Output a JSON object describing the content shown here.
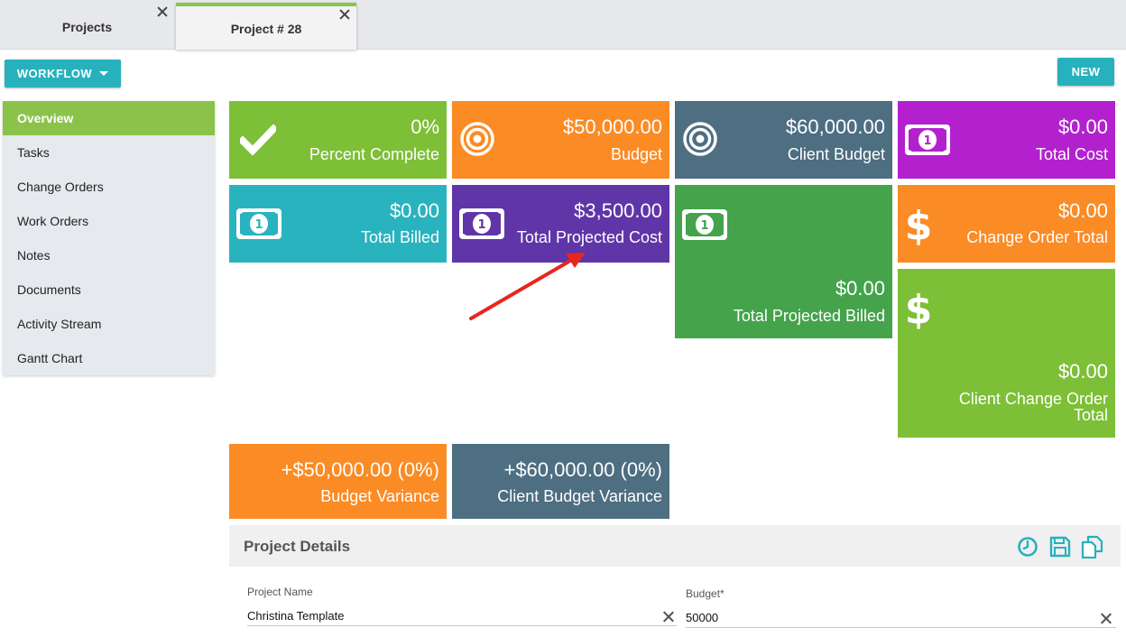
{
  "tabs": [
    {
      "label": "Projects"
    },
    {
      "label": "Project # 28"
    }
  ],
  "toolbar": {
    "workflow_label": "WORKFLOW",
    "new_label": "NEW"
  },
  "sidebar": {
    "items": [
      {
        "label": "Overview",
        "active": true
      },
      {
        "label": "Tasks"
      },
      {
        "label": "Change Orders"
      },
      {
        "label": "Work Orders"
      },
      {
        "label": "Notes"
      },
      {
        "label": "Documents"
      },
      {
        "label": "Activity Stream"
      },
      {
        "label": "Gantt Chart"
      }
    ]
  },
  "tiles": {
    "percent_complete": {
      "value": "0%",
      "label": "Percent Complete",
      "icon": "checkmark-icon",
      "color": "#7dbf37"
    },
    "budget": {
      "value": "$50,000.00",
      "label": "Budget",
      "icon": "target-icon",
      "color": "#fb8b24"
    },
    "client_budget": {
      "value": "$60,000.00",
      "label": "Client Budget",
      "icon": "target-icon",
      "color": "#4e6e82"
    },
    "total_cost": {
      "value": "$0.00",
      "label": "Total Cost",
      "icon": "money-icon",
      "color": "#b321cf"
    },
    "total_billed": {
      "value": "$0.00",
      "label": "Total Billed",
      "icon": "money-icon",
      "color": "#29b3bf"
    },
    "total_projected_cost": {
      "value": "$3,500.00",
      "label": "Total Projected Cost",
      "icon": "money-icon",
      "color": "#6035a8"
    },
    "total_projected_billed": {
      "value": "$0.00",
      "label": "Total Projected Billed",
      "icon": "money-icon",
      "color": "#44a34b"
    },
    "change_order_total": {
      "value": "$0.00",
      "label": "Change Order Total",
      "icon": "dollar-icon",
      "color": "#fb8b24"
    },
    "client_change_order_total": {
      "value": "$0.00",
      "label": "Client Change Order Total",
      "icon": "dollar-icon",
      "color": "#7dbf37"
    },
    "budget_variance": {
      "value": "+$50,000.00 (0%)",
      "label": "Budget Variance",
      "color": "#fb8b24"
    },
    "client_budget_variance": {
      "value": "+$60,000.00 (0%)",
      "label": "Client Budget Variance",
      "color": "#4e6e82"
    }
  },
  "annotation": {
    "color": "#e8261e",
    "icon": "red-arrow-annotation"
  },
  "details": {
    "title": "Project Details",
    "icons": [
      "clock-icon",
      "save-icon",
      "copy-icon"
    ],
    "accent": "#27b1bd",
    "fields": {
      "project_name": {
        "label": "Project Name",
        "value": "Christina Template"
      },
      "budget": {
        "label": "Budget*",
        "value": "50000"
      }
    }
  }
}
